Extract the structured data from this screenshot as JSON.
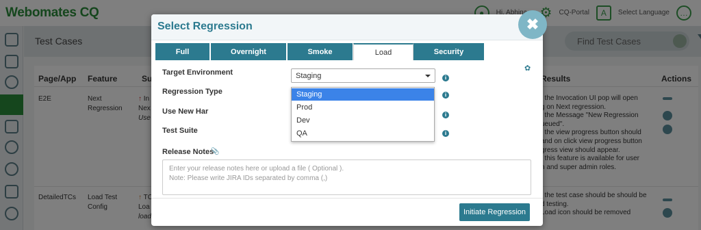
{
  "app": {
    "logo": "Webomates CQ",
    "user": "Hi, Abhina...",
    "portal": "CQ-Portal",
    "language": "Select Language"
  },
  "page": {
    "title": "Test Cases",
    "search_placeholder": "Find Test Cases"
  },
  "table": {
    "headers": [
      "Page/App",
      "Feature",
      "Su",
      "Results",
      "Actions"
    ],
    "rows": [
      {
        "page": "E2E",
        "feature": [
          "Next",
          "Regression"
        ],
        "summary": [
          "In",
          "Nex",
          "Use"
        ],
        "results": [
          "t the Invocation UI pop will open",
          "g on Next regression.",
          "t the Message \"New Regression",
          "ueued\".",
          "t the view progress button should",
          "and on click view progress button",
          "gress view should appear.",
          "t this feature is available for user",
          "n and super admin roles."
        ]
      },
      {
        "page": "DetailedTCs",
        "feature": [
          "Load Test",
          "Config"
        ],
        "summary": [
          "TC",
          "Loa",
          "load"
        ],
        "results": [
          "t the test case should be should be",
          "d testing.",
          "Load icon should be removed"
        ]
      }
    ]
  },
  "modal": {
    "title": "Select Regression",
    "close": "✖",
    "tabs": [
      {
        "label": "Full",
        "active": false
      },
      {
        "label": "Overnight",
        "active": false
      },
      {
        "label": "Smoke",
        "active": false
      },
      {
        "label": "Load",
        "active": true
      },
      {
        "label": "Security",
        "active": false
      }
    ],
    "fields": {
      "target_environment": "Target Environment",
      "regression_type": "Regression Type",
      "use_new_har": "Use New Har",
      "test_suite": "Test Suite"
    },
    "environment_select": {
      "value": "Staging",
      "options": [
        "Staging",
        "Prod",
        "Dev",
        "QA"
      ],
      "highlighted": "Staging"
    },
    "release_notes": {
      "label": "Release Notes",
      "placeholder_line1": "Enter your release notes here or upload a file ( Optional ).",
      "placeholder_line2": "Note: Please write JIRA IDs separated by comma (,)"
    },
    "primary_button": "Initiate Regression"
  },
  "colors": {
    "brand_green": "#2a8c3a",
    "accent_teal": "#2c7a8f",
    "dropdown_highlight": "#3b83e8",
    "close_button": "#7fb6c6"
  }
}
